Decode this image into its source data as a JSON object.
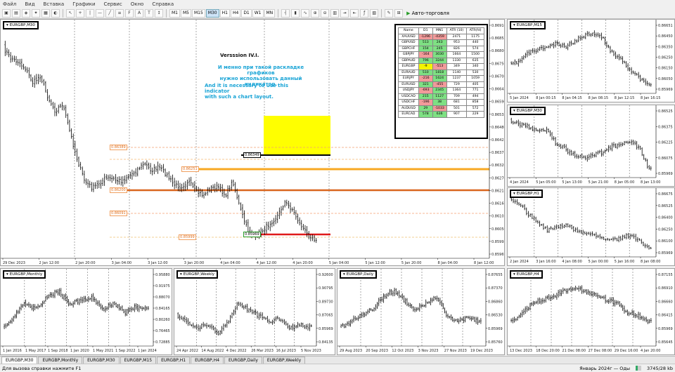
{
  "menu": [
    "Файл",
    "Вид",
    "Вставка",
    "Графики",
    "Сервис",
    "Окно",
    "Справка"
  ],
  "toolbar": {
    "timeframes": [
      "M1",
      "M5",
      "M15",
      "M30",
      "H1",
      "H4",
      "D1",
      "W1",
      "MN"
    ],
    "active_tf": "M30",
    "autotrade_label": "Авто-торговля"
  },
  "main": {
    "title": "EURGBP,M30",
    "annotation_version": "Versssion IV.I.",
    "annotation_ru": [
      "И менно при такой раскладке графиков",
      "нужно использовать данный индикатор."
    ],
    "annotation_en": [
      "And it is necessary to use this indicator",
      "with such a chart layout."
    ],
    "level_labels": [
      "0.86389",
      "0.86251",
      "0.86200",
      "0.86091",
      "0.85999"
    ],
    "price_tags": [
      "0.86349",
      "0.85969"
    ],
    "y_ticks": [
      "0.86910",
      "0.86855",
      "0.86800",
      "0.86750",
      "0.86700",
      "0.86645",
      "0.86590",
      "0.86535",
      "0.86480",
      "0.86425",
      "0.86375",
      "0.86320",
      "0.86270",
      "0.86215",
      "0.86160",
      "0.86105",
      "0.86050",
      "0.85995",
      "0.85969"
    ],
    "x_ticks": [
      "29 Dec 2023",
      "2 Jan 12:00",
      "2 Jan 20:00",
      "3 Jan 04:00",
      "3 Jan 12:00",
      "3 Jan 20:00",
      "4 Jan 04:00",
      "4 Jan 12:00",
      "4 Jan 20:00",
      "5 Jan 04:00",
      "5 Jan 12:00",
      "5 Jan 20:00",
      "8 Jan 04:00",
      "8 Jan 12:00"
    ]
  },
  "table": {
    "headers": [
      "Name",
      "D1",
      "MN1",
      "ATR (10)",
      "ATR(fd)"
    ],
    "rows": [
      [
        "XAUUSD",
        "-1296",
        "-4359",
        "2471",
        "1175"
      ],
      [
        "GBPUSD",
        "513",
        "243",
        "953",
        "440"
      ],
      [
        "GBPCHF",
        "154",
        "245",
        "826",
        "574"
      ],
      [
        "GBPJPY",
        "-164",
        "3030",
        "1664",
        "1500"
      ],
      [
        "GBPAUD",
        "796",
        "3244",
        "1330",
        "635"
      ],
      [
        "EURGBP",
        "-9",
        "-513",
        "349",
        "340"
      ],
      [
        "EURAUD",
        "510",
        "1818",
        "1140",
        "530"
      ],
      [
        "EURJPY",
        "-216",
        "1624",
        "1237",
        "1059"
      ],
      [
        "EURUSD",
        "321",
        "-455",
        "729",
        "405"
      ],
      [
        "USDJPY",
        "-693",
        "2345",
        "1364",
        "771"
      ],
      [
        "USDCAD",
        "215",
        "1127",
        "709",
        "494"
      ],
      [
        "USDCHF",
        "-196",
        "38",
        "681",
        "858"
      ],
      [
        "AUDUSD",
        "29",
        "-1033",
        "501",
        "572"
      ],
      [
        "EURCAD",
        "578",
        "636",
        "907",
        "229"
      ]
    ],
    "colors": [
      [
        "w",
        "r",
        "r",
        "w",
        "w"
      ],
      [
        "w",
        "g",
        "g",
        "w",
        "w"
      ],
      [
        "w",
        "g",
        "g",
        "w",
        "w"
      ],
      [
        "w",
        "r",
        "g",
        "w",
        "w"
      ],
      [
        "w",
        "g",
        "g",
        "w",
        "w"
      ],
      [
        "w",
        "y",
        "r",
        "w",
        "w"
      ],
      [
        "w",
        "g",
        "g",
        "w",
        "w"
      ],
      [
        "w",
        "r",
        "g",
        "w",
        "w"
      ],
      [
        "w",
        "g",
        "r",
        "w",
        "w"
      ],
      [
        "w",
        "r",
        "g",
        "w",
        "w"
      ],
      [
        "w",
        "g",
        "g",
        "w",
        "w"
      ],
      [
        "w",
        "r",
        "g",
        "w",
        "w"
      ],
      [
        "w",
        "g",
        "r",
        "w",
        "w"
      ],
      [
        "w",
        "g",
        "g",
        "w",
        "w"
      ]
    ]
  },
  "side_charts": [
    {
      "title": "EURGBP,M15",
      "y_ticks": [
        "0.86651",
        "0.86450",
        "0.86350",
        "0.86250",
        "0.86150",
        "0.86050",
        "0.85969"
      ],
      "x_ticks": [
        "5 Jan 2024",
        "8 Jan 00:15",
        "8 Jan 04:15",
        "8 Jan 08:15",
        "8 Jan 12:15",
        "8 Jan 16:15"
      ]
    },
    {
      "title": "EURGBP,M30",
      "y_ticks": [
        "0.86525",
        "0.86375",
        "0.86225",
        "0.86075",
        "0.85969"
      ],
      "x_ticks": [
        "4 Jan 2024",
        "5 Jan 05:00",
        "5 Jan 13:00",
        "5 Jan 21:00",
        "8 Jan 05:00",
        "8 Jan 13:00"
      ]
    },
    {
      "title": "EURGBP,H1",
      "y_ticks": [
        "0.86675",
        "0.86525",
        "0.86400",
        "0.86250",
        "0.86100",
        "0.85969"
      ],
      "x_ticks": [
        "2 Jan 2024",
        "3 Jan 16:00",
        "4 Jan 08:00",
        "5 Jan 00:00",
        "5 Jan 16:00",
        "8 Jan 08:00"
      ]
    }
  ],
  "bottom_charts": [
    {
      "title": "EURGBP,Monthly",
      "y_ticks": [
        "0.95880",
        "0.91975",
        "0.88070",
        "0.84165",
        "0.80260",
        "0.76465",
        "0.72885"
      ],
      "x_ticks": [
        "1 Jan 2016",
        "1 May 2017",
        "1 Sep 2018",
        "1 Jan 2020",
        "1 May 2021",
        "1 Sep 2022",
        "1 Jan 2024"
      ]
    },
    {
      "title": "EURGBP,Weekly",
      "y_ticks": [
        "0.92600",
        "0.90795",
        "0.89730",
        "0.87065",
        "0.85969",
        "0.84135"
      ],
      "x_ticks": [
        "24 Apr 2022",
        "14 Aug 2022",
        "4 Dec 2022",
        "26 Mar 2023",
        "16 Jul 2023",
        "5 Nov 2023"
      ]
    },
    {
      "title": "EURGBP,Daily",
      "y_ticks": [
        "0.87655",
        "0.87370",
        "0.86860",
        "0.86530",
        "0.85969",
        "0.85760"
      ],
      "x_ticks": [
        "29 Aug 2023",
        "20 Sep 2023",
        "12 Oct 2023",
        "3 Nov 2023",
        "27 Nov 2023",
        "19 Dec 2023"
      ]
    },
    {
      "title": "EURGBP,H4",
      "y_ticks": [
        "0.87155",
        "0.86910",
        "0.86660",
        "0.86415",
        "0.85969",
        "0.85645"
      ],
      "x_ticks": [
        "13 Dec 2023",
        "18 Dec 20:00",
        "21 Dec 08:00",
        "27 Dec 08:00",
        "29 Dec 16:00",
        "4 Jan 20:00"
      ]
    }
  ],
  "tabs": [
    "EURGBP,M30",
    "EURGBP,Monthly",
    "EURGBP,M30",
    "EURGBP,M15",
    "EURGBP,H1",
    "EURGBP,H4",
    "EURGBP,Daily",
    "EURGBP,Weekly"
  ],
  "status": {
    "help": "Для вызова справки нажмите F1",
    "profile": "Январь 2024г — Оды",
    "traffic": "3745/28 kb"
  }
}
